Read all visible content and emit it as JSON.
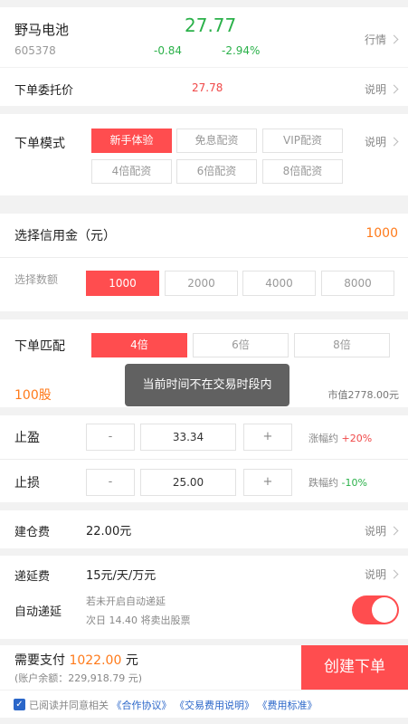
{
  "stock": {
    "name": "野马电池",
    "code": "605378",
    "price": "27.77",
    "change": "-0.84",
    "change_pct": "-2.94%",
    "quote_link": "行情"
  },
  "order_price": {
    "label": "下单委托价",
    "value": "27.78",
    "help": "说明"
  },
  "order_mode": {
    "label": "下单模式",
    "options": [
      "新手体验",
      "免息配资",
      "VIP配资",
      "4倍配资",
      "6倍配资",
      "8倍配资"
    ],
    "selected_index": 0,
    "help": "说明"
  },
  "credit": {
    "label": "选择信用金（元）",
    "value": "1000",
    "amount_label": "选择数额",
    "amounts": [
      "1000",
      "2000",
      "4000",
      "8000"
    ],
    "selected_index": 0
  },
  "match": {
    "label": "下单匹配",
    "options": [
      "4倍",
      "6倍",
      "8倍"
    ],
    "selected_index": 0,
    "shares": "100股",
    "market_value": "市值2778.00元"
  },
  "toast": "当前时间不在交易时段内",
  "take_profit": {
    "label": "止盈",
    "minus": "-",
    "value": "33.34",
    "plus": "+",
    "note_prefix": "涨幅约",
    "note_value": "+20%"
  },
  "stop_loss": {
    "label": "止损",
    "minus": "-",
    "value": "25.00",
    "plus": "+",
    "note_prefix": "跌幅约",
    "note_value": "-10%"
  },
  "open_fee": {
    "label": "建仓费",
    "value": "22.00元",
    "help": "说明"
  },
  "defer_fee": {
    "label": "递延费",
    "value": "15元/天/万元",
    "help": "说明"
  },
  "auto_defer": {
    "label": "自动递延",
    "line1": "若未开启自动递延",
    "line2": "次日 14.40 将卖出股票",
    "enabled": true
  },
  "payment": {
    "label": "需要支付",
    "amount": "1022.00",
    "unit": "元",
    "balance": "(账户余额：229,918.79 元)",
    "submit": "创建下单"
  },
  "agreement": {
    "checked": true,
    "text": "已阅读并同意相关",
    "links": [
      "《合作协议》",
      "《交易费用说明》",
      "《费用标准》"
    ]
  },
  "colors": {
    "accent": "#ff4d4f",
    "up": "#f04848",
    "down": "#2bb14a",
    "highlight": "#ff7a1a",
    "link": "#2a66c9"
  }
}
